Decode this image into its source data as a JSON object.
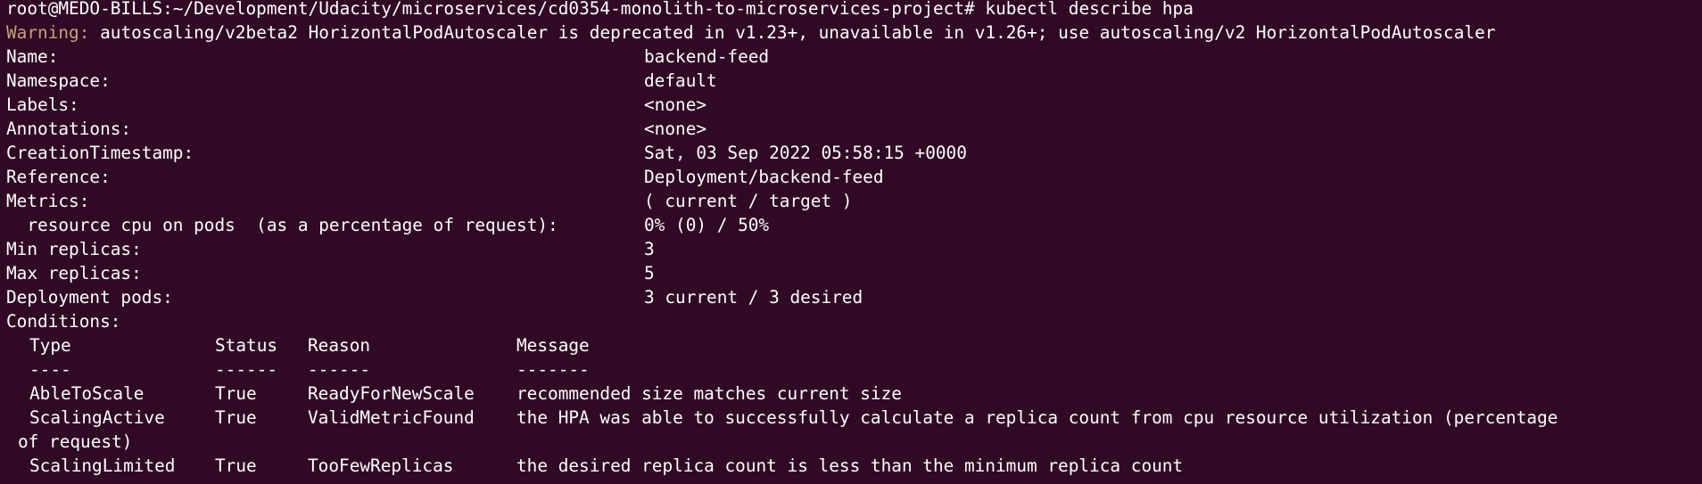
{
  "colors": {
    "background": "#300a24",
    "foreground": "#ffffff",
    "warning": "#c8a07a"
  },
  "prompt": {
    "text": "root@MEDO-BILLS:~/Development/Udacity/microservices/cd0354-monolith-to-microservices-project#",
    "command": "kubectl describe hpa"
  },
  "warning": {
    "label": "Warning:",
    "message": "autoscaling/v2beta2 HorizontalPodAutoscaler is deprecated in v1.23+, unavailable in v1.26+; use autoscaling/v2 HorizontalPodAutoscaler"
  },
  "fields": [
    {
      "key": "Name:",
      "value": "backend-feed"
    },
    {
      "key": "Namespace:",
      "value": "default"
    },
    {
      "key": "Labels:",
      "value": "<none>"
    },
    {
      "key": "Annotations:",
      "value": "<none>"
    },
    {
      "key": "CreationTimestamp:",
      "value": "Sat, 03 Sep 2022 05:58:15 +0000"
    },
    {
      "key": "Reference:",
      "value": "Deployment/backend-feed"
    },
    {
      "key": "Metrics:",
      "value": "( current / target )"
    },
    {
      "key": "  resource cpu on pods  (as a percentage of request):",
      "value": "0% (0) / 50%"
    },
    {
      "key": "Min replicas:",
      "value": "3"
    },
    {
      "key": "Max replicas:",
      "value": "5"
    },
    {
      "key": "Deployment pods:",
      "value": "3 current / 3 desired"
    }
  ],
  "conditions": {
    "label": "Conditions:",
    "headers": [
      "Type",
      "Status",
      "Reason",
      "Message"
    ],
    "underlines": [
      "----",
      "------",
      "------",
      "-------"
    ],
    "rows": [
      {
        "type": "AbleToScale",
        "status": "True",
        "reason": "ReadyForNewScale",
        "message": "recommended size matches current size",
        "wrap": ""
      },
      {
        "type": "ScalingActive",
        "status": "True",
        "reason": "ValidMetricFound",
        "message": "the HPA was able to successfully calculate a replica count from cpu resource utilization (percentage",
        "wrap": "of request)"
      },
      {
        "type": "ScalingLimited",
        "status": "True",
        "reason": "TooFewReplicas",
        "message": "the desired replica count is less than the minimum replica count",
        "wrap": ""
      }
    ]
  }
}
